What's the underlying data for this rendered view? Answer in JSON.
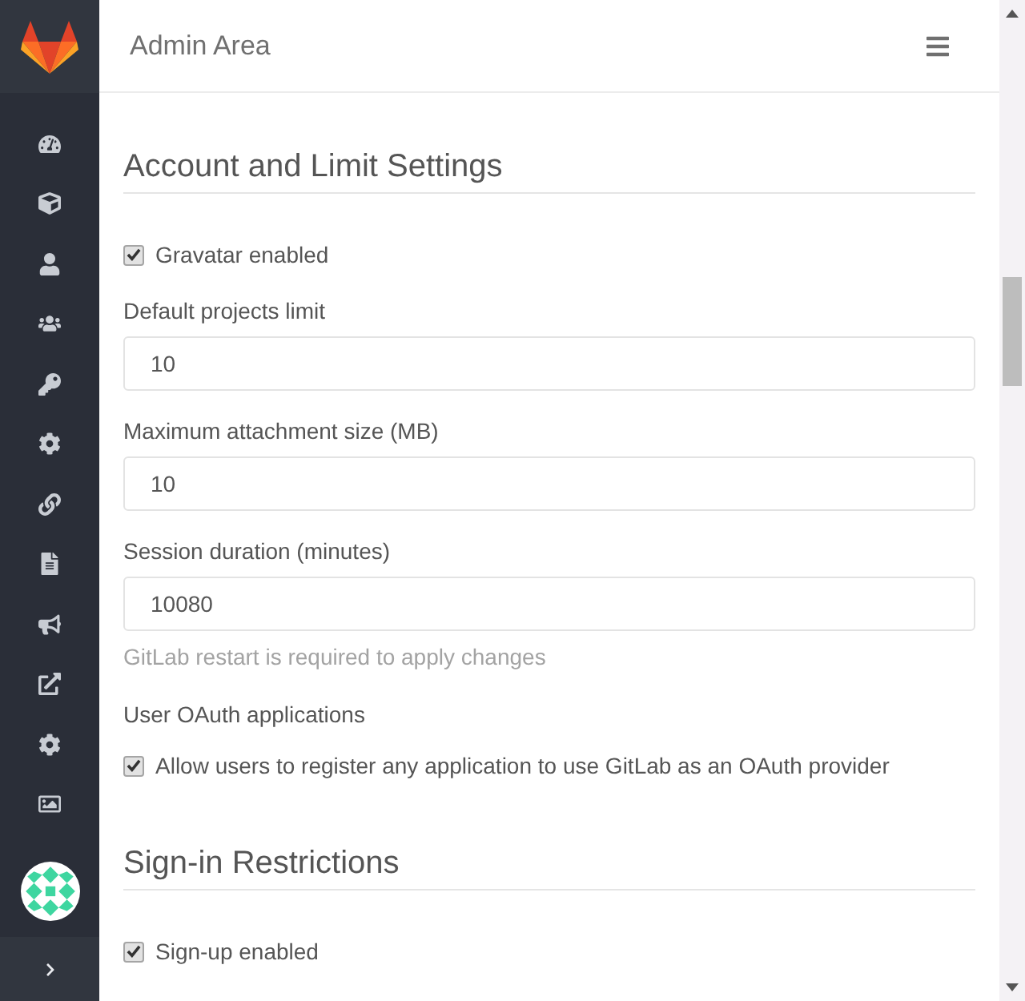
{
  "header": {
    "title": "Admin Area"
  },
  "sections": [
    {
      "title": "Account and Limit Settings",
      "fields": [
        {
          "kind": "checkbox",
          "label": "Gravatar enabled",
          "checked": true
        },
        {
          "kind": "input",
          "label": "Default projects limit",
          "value": "10"
        },
        {
          "kind": "input",
          "label": "Maximum attachment size (MB)",
          "value": "10"
        },
        {
          "kind": "input",
          "label": "Session duration (minutes)",
          "value": "10080",
          "help": "GitLab restart is required to apply changes"
        },
        {
          "kind": "label",
          "label": "User OAuth applications"
        },
        {
          "kind": "checkbox",
          "label": "Allow users to register any application to use GitLab as an OAuth provider",
          "checked": true
        }
      ]
    },
    {
      "title": "Sign-in Restrictions",
      "fields": [
        {
          "kind": "checkbox",
          "label": "Sign-up enabled",
          "checked": true
        }
      ]
    }
  ]
}
